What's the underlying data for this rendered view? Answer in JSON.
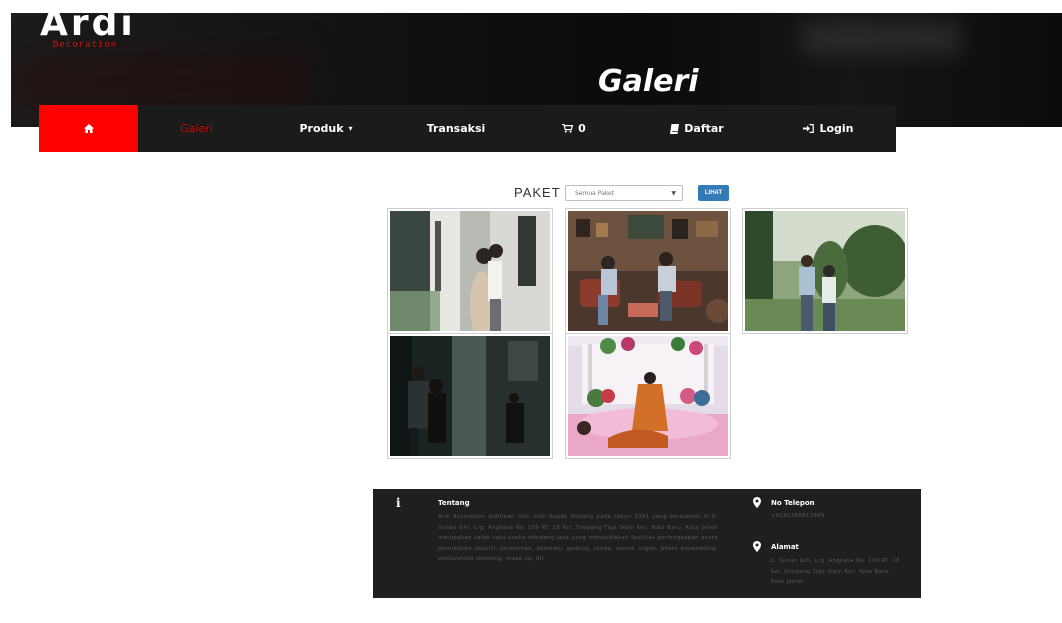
{
  "header": {
    "logo": "Ardi",
    "logo_sub": "Decoration",
    "page_heading": "Galeri"
  },
  "nav": {
    "home_icon": "home-icon",
    "galeri": "Galeri",
    "produk": "Produk",
    "produk_caret": "▾",
    "transaksi": "Transaksi",
    "cart_icon": "cart-icon",
    "cart_count": "0",
    "daftar_icon": "book-icon",
    "daftar": "Daftar",
    "login_icon": "sign-in-icon",
    "login": "Login"
  },
  "filter": {
    "label": "PAKET",
    "selected": "Semua Paket",
    "button": "LIHAT"
  },
  "gallery": [
    {
      "alt": "couple-in-alley-photo"
    },
    {
      "alt": "couple-indoor-vintage-photo"
    },
    {
      "alt": "couple-in-garden-photo"
    },
    {
      "alt": "couple-night-street-photo"
    },
    {
      "alt": "bride-in-decoration-photo"
    }
  ],
  "footer": {
    "about": {
      "icon": "info-icon",
      "title": "Tentang",
      "text": "Ardi decoration didirikan oleh oleh bapak Dodang pada tahun 2001 yang beralamat di Jl. Sunan Giri, Lrg. Angkasa No. 100 RT. 10 Kel. Simpang Tiga Sipin Kec. Kota Baru, Kota Jambi merupakan salah satu usaha dibidang jasa yang menyediakan fasilitas perlengkapan acara pernikahan seperti: pelaminan, dekorasi, gedung, tenda, sound, organ, photo prewedding, photo/video shooting, make up, dll."
    },
    "phone": {
      "icon": "map-marker-icon",
      "title": "No Telepon",
      "value": "+6281366813999"
    },
    "address": {
      "icon": "map-marker-icon",
      "title": "Alamat",
      "value": "Jl. Sunan Giri, Lrg. Angkasa No. 100 RT. 10 Kel. Simpang Tiga Sipin Kec. Kota Baru, Kota Jambi"
    }
  }
}
